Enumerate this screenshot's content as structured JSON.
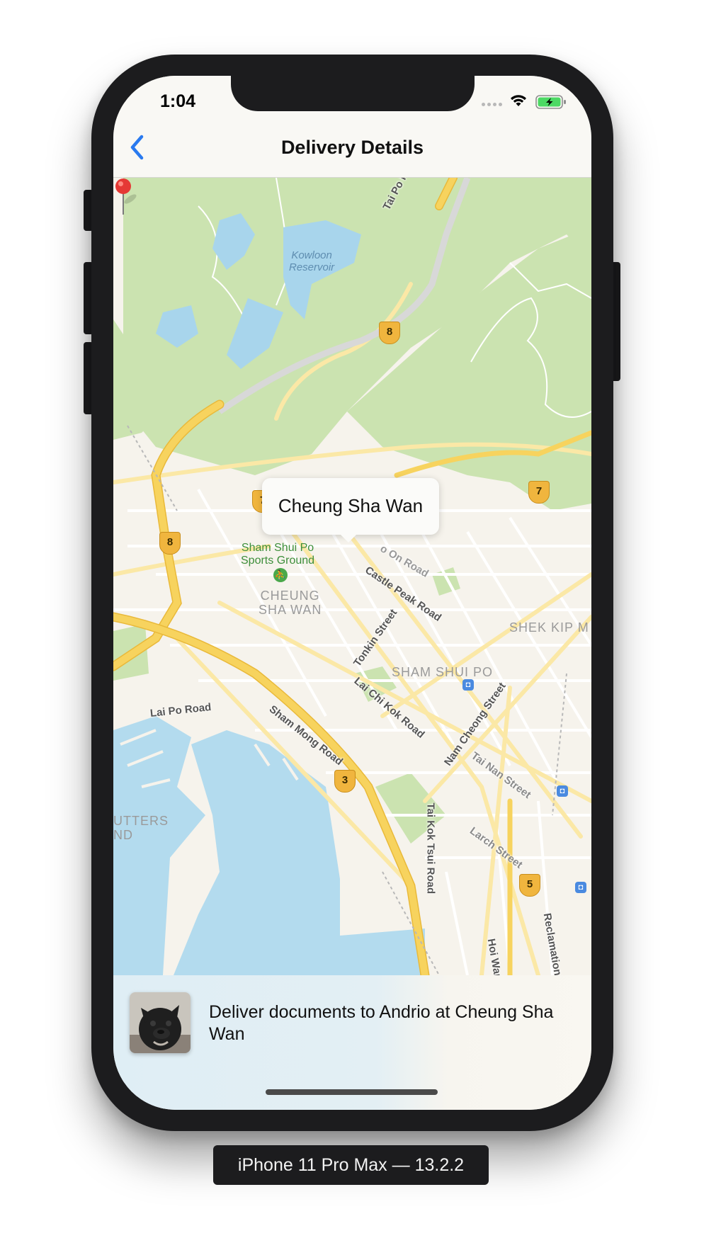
{
  "status_bar": {
    "time": "1:04"
  },
  "nav": {
    "title": "Delivery Details",
    "back_icon": "chevron-left-icon"
  },
  "map": {
    "callout_title": "Cheung Sha Wan",
    "pin_color": "#e53935",
    "water_label": "Kowloon\nReservoir",
    "park_label": "Sham Shui Po\nSports Ground",
    "districts": {
      "cheung_sha_wan": "CHEUNG\nSHA WAN",
      "sham_shui_po": "SHAM SHUI PO",
      "shek_kip_mei": "SHEK KIP M",
      "stonecutters": "UTTERS\nND"
    },
    "streets": {
      "tai_po_road": "Tai Po Road – Sha Ti",
      "castle_peak_road": "Castle Peak Road",
      "tonkin_street": "Tonkin Street",
      "lai_chi_kok_road": "Lai Chi Kok Road",
      "sham_mong_road": "Sham Mong Road",
      "lai_po_road": "Lai Po Road",
      "nam_cheong_street": "Nam Cheong Street",
      "tai_nan_street": "Tai Nan Street",
      "larch_street": "Larch Street",
      "tai_kok_tsui_road": "Tai Kok Tsui Road",
      "hoi_wang": "Hoi Wan",
      "reclamation": "Reclamation",
      "on_road": "o On Road"
    },
    "route_shields": [
      "8",
      "8",
      "7",
      "3",
      "5",
      "7"
    ]
  },
  "delivery": {
    "description": "Deliver documents to Andrio at Cheung Sha Wan"
  },
  "device_label": "iPhone 11 Pro Max — 13.2.2",
  "colors": {
    "accent": "#2a7aef",
    "map_background": "#f6f3ec",
    "park_green": "#cbe3b0",
    "water_blue": "#b3dbee",
    "highway_yellow": "#f7d35e"
  }
}
